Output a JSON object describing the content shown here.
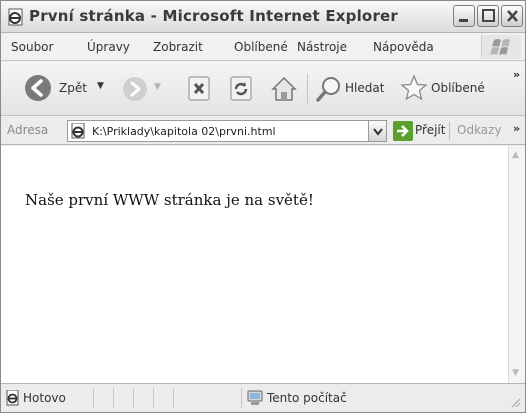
{
  "window": {
    "title": "První stránka - Microsoft Internet Explorer"
  },
  "menu": {
    "items": [
      "Soubor",
      "Úpravy",
      "Zobrazit",
      "Oblíbené",
      "Nástroje",
      "Nápověda"
    ]
  },
  "toolbar": {
    "back_label": "Zpět",
    "search_label": "Hledat",
    "favorites_label": "Oblíbené"
  },
  "address": {
    "label": "Adresa",
    "value": "K:\\Priklady\\kapitola 02\\prvni.html",
    "go_label": "Přejít",
    "links_label": "Odkazy"
  },
  "page": {
    "text": "Naše první WWW stránka je na světě!"
  },
  "status": {
    "text": "Hotovo",
    "zone": "Tento počítač"
  },
  "colors": {
    "accent_green": "#5aa02c",
    "arrow_gray": "#7a7a7a"
  },
  "icons": [
    "ie-page-icon",
    "minimize-icon",
    "maximize-icon",
    "close-icon",
    "back-arrow-icon",
    "forward-arrow-icon",
    "stop-icon",
    "refresh-icon",
    "home-icon",
    "search-icon",
    "favorites-star-icon",
    "go-arrow-icon",
    "computer-icon",
    "resize-grip-icon",
    "windows-logo-icon"
  ]
}
